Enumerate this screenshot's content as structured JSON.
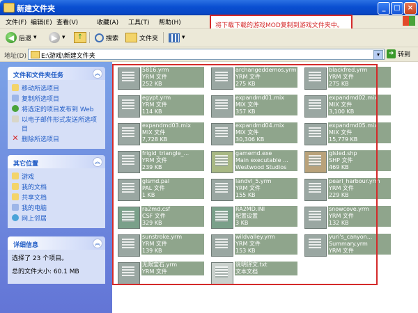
{
  "window": {
    "title": "新建文件夹",
    "buttons": [
      "_",
      "□",
      "×"
    ]
  },
  "menu": [
    "文件(F)",
    "编辑(E)",
    "查看(V)",
    "收藏(A)",
    "工具(T)",
    "帮助(H)"
  ],
  "toolbar": {
    "back": "后退",
    "search": "搜索",
    "folders": "文件夹"
  },
  "address": {
    "label": "地址(D)",
    "path": "E:\\游戏\\新建文件夹",
    "go": "转到"
  },
  "callout": "将下载下载的游戏MOD复制到游戏文件夹中。",
  "left": {
    "tasks_title": "文件和文件夹任务",
    "tasks": [
      "移动所选项目",
      "复制所选项目",
      "将选定的项目发布到 Web",
      "以电子邮件形式发送所选项目",
      "删除所选项目"
    ],
    "places_title": "其它位置",
    "places": [
      "游戏",
      "我的文档",
      "共享文档",
      "我的电脑",
      "网上邻居"
    ],
    "details_title": "详细信息",
    "details": [
      "选择了 23 个项目。",
      "总的文件大小: 60.1 MB"
    ]
  },
  "files": [
    {
      "name": "5816.yrm",
      "type": "YRM 文件",
      "size": "252 KB",
      "icon": "file-icon"
    },
    {
      "name": "archangeddemos.yrm",
      "type": "YRM 文件",
      "size": "275 KB",
      "icon": "file-icon"
    },
    {
      "name": "blackfred.yrm",
      "type": "YRM 文件",
      "size": "275 KB",
      "icon": "file-icon"
    },
    {
      "name": "egypt.yrm",
      "type": "YRM 文件",
      "size": "114 KB",
      "icon": "file-icon"
    },
    {
      "name": "expandmd01.mix",
      "type": "MIX 文件",
      "size": "357 KB",
      "icon": "file-icon"
    },
    {
      "name": "expandmd02.mix",
      "type": "MIX 文件",
      "size": "3,100 KB",
      "icon": "file-icon"
    },
    {
      "name": "expandmd03.mix",
      "type": "MIX 文件",
      "size": "7,728 KB",
      "icon": "file-icon"
    },
    {
      "name": "expandmd04.mix",
      "type": "MIX 文件",
      "size": "30,306 KB",
      "icon": "file-icon"
    },
    {
      "name": "expandmd05.mix",
      "type": "MIX 文件",
      "size": "15,779 KB",
      "icon": "file-icon"
    },
    {
      "name": "frigid_triangle_...",
      "type": "YRM 文件",
      "size": "239 KB",
      "icon": "file-icon"
    },
    {
      "name": "gamemd.exe",
      "type": "Main executable ...",
      "size": "Westwood Studios",
      "icon": "exe-icon"
    },
    {
      "name": "glsled.shp",
      "type": "SHP 文件",
      "size": "469 KB",
      "icon": "shp-icon"
    },
    {
      "name": "glsmd.pal",
      "type": "PAL 文件",
      "size": "1 KB",
      "icon": "file-icon"
    },
    {
      "name": "landvl_5.yrm",
      "type": "YRM 文件",
      "size": "155 KB",
      "icon": "file-icon"
    },
    {
      "name": "pearl_harbour.yrm",
      "type": "YRM 文件",
      "size": "229 KB",
      "icon": "file-icon"
    },
    {
      "name": "ra2md.csf",
      "type": "CSF 文件",
      "size": "329 KB",
      "icon": "cfg-icon"
    },
    {
      "name": "RA2MD.INI",
      "type": "配置设置",
      "size": "3 KB",
      "icon": "cfg-icon"
    },
    {
      "name": "snowcove.yrm",
      "type": "YRM 文件",
      "size": "132 KB",
      "icon": "file-icon"
    },
    {
      "name": "sunstroke.yrm",
      "type": "YRM 文件",
      "size": "139 KB",
      "icon": "file-icon"
    },
    {
      "name": "wildvalley.yrm",
      "type": "YRM 文件",
      "size": "153 KB",
      "icon": "file-icon"
    },
    {
      "name": "yuri's_canyon...",
      "type": "Summary.yrm",
      "size": "YRM 文件",
      "icon": "file-icon"
    },
    {
      "name": "无限宝石.yrm",
      "type": "YRM 文件",
      "size": "",
      "icon": "file-icon"
    },
    {
      "name": "说明译文.txt",
      "type": "文本文档",
      "size": "",
      "icon": "txt-icon"
    }
  ],
  "colors": {
    "title_blue": "#0a4fd1",
    "selection": "#8fa58c",
    "annotation_red": "#d42a2a"
  }
}
